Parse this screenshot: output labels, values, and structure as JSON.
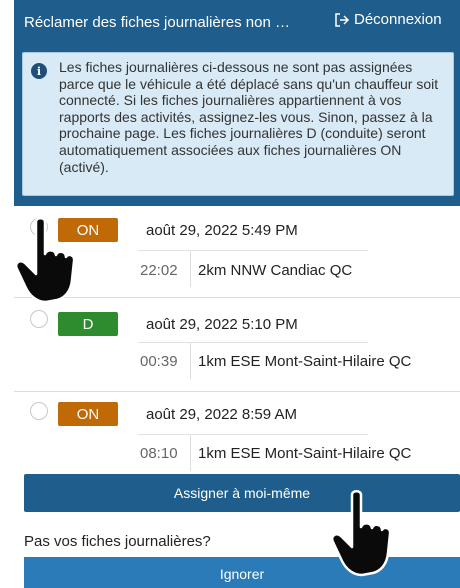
{
  "header": {
    "title": "Réclamer des fiches journalières non …",
    "logout_label": "Déconnexion"
  },
  "banner": {
    "icon": "info-icon",
    "text": "Les fiches journalières ci-dessous ne sont pas assignées parce que le véhicule a été déplacé sans qu'un chauffeur soit connecté. Si les fiches journalières appartiennent à vos rapports des activités, assignez-les vous. Sinon, passez à la prochaine page. Les fiches journalières D (conduite) seront automatiquement associées aux fiches journalières ON (activé)."
  },
  "logs": [
    {
      "status": "ON",
      "date": "août 29, 2022 5:49 PM",
      "duration": "22:02",
      "location": "2km NNW Candiac QC",
      "status_color": "#bf6a07"
    },
    {
      "status": "D",
      "date": "août 29, 2022 5:10 PM",
      "duration": "00:39",
      "location": "1km ESE Mont-Saint-Hilaire QC",
      "status_color": "#2e8b2e"
    },
    {
      "status": "ON",
      "date": "août 29, 2022 8:59 AM",
      "duration": "08:10",
      "location": "1km ESE Mont-Saint-Hilaire QC",
      "status_color": "#bf6a07"
    }
  ],
  "actions": {
    "assign_label": "Assigner à moi-même",
    "not_yours_label": "Pas vos fiches journalières?",
    "ignore_label": "Ignorer"
  },
  "colors": {
    "primary": "#1f5e8c",
    "banner_bg": "#d8eaf6",
    "ignore_button": "#2b7bb8"
  }
}
